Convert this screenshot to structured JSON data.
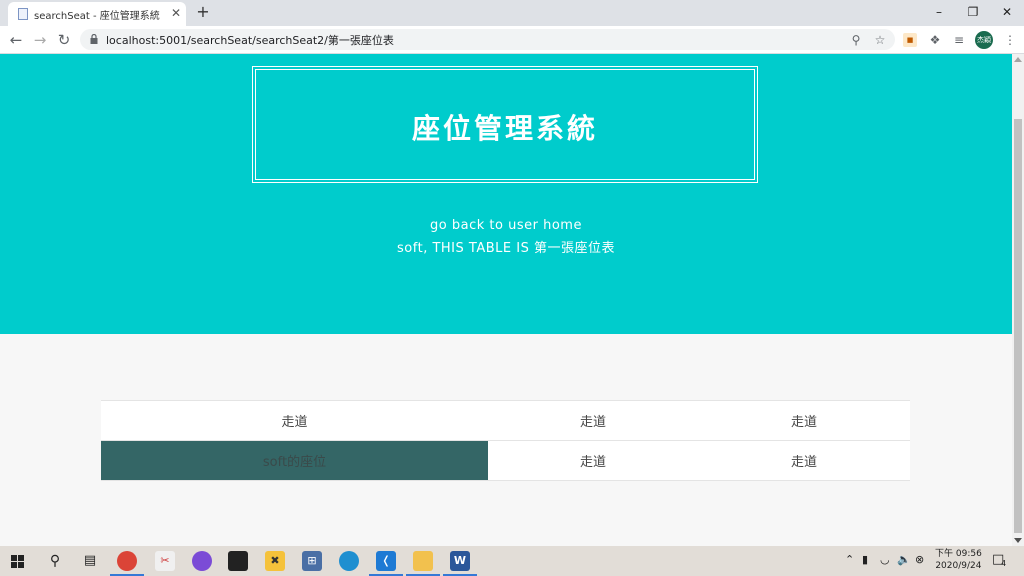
{
  "browser": {
    "tab": {
      "title": "searchSeat - 座位管理系統",
      "close_glyph": "✕",
      "favicon": "page-icon"
    },
    "new_tab_glyph": "+",
    "window_controls": {
      "minimize": "–",
      "restore": "❐",
      "close": "✕"
    },
    "url": "localhost:5001/searchSeat/searchSeat2/第一張座位表",
    "profile_label": "杰穎"
  },
  "page": {
    "title": "座位管理系統",
    "back_link": "go back to user home",
    "subtitle": "soft, THIS TABLE IS 第一張座位表",
    "seat_rows": [
      [
        "走道",
        "走道",
        "走道"
      ],
      [
        "soft的座位",
        "走道",
        "走道"
      ]
    ],
    "colors": {
      "hero": "#00cccc",
      "occupied_seat": "#346666"
    }
  },
  "taskbar": {
    "clock_time": "下午 09:56",
    "clock_date": "2020/9/24",
    "notification_count": "4"
  }
}
